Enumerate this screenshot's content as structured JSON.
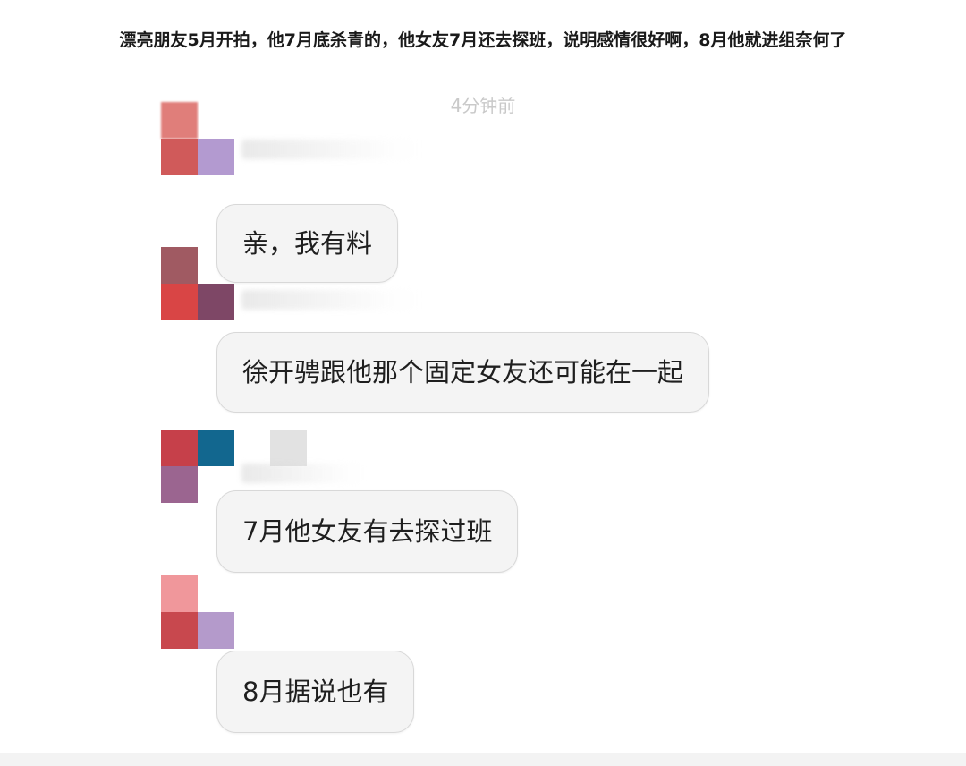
{
  "caption": "漂亮朋友5月开拍，他7月底杀青的，他女友7月还去探班，说明感情很好啊，8月他就进组奈何了",
  "chat": {
    "timestamp": "4分钟前",
    "messages": [
      {
        "text": "亲，我有料"
      },
      {
        "text": "徐开骋跟他那个固定女友还可能在一起"
      },
      {
        "text": "7月他女友有去探过班"
      },
      {
        "text": "8月据说也有"
      }
    ]
  },
  "colors": {
    "bubble_bg": "#f4f4f4",
    "bubble_border": "#d8d8d8",
    "timestamp": "#c9c9c9"
  },
  "icons": {
    "avatar": "pixelated-avatar"
  }
}
